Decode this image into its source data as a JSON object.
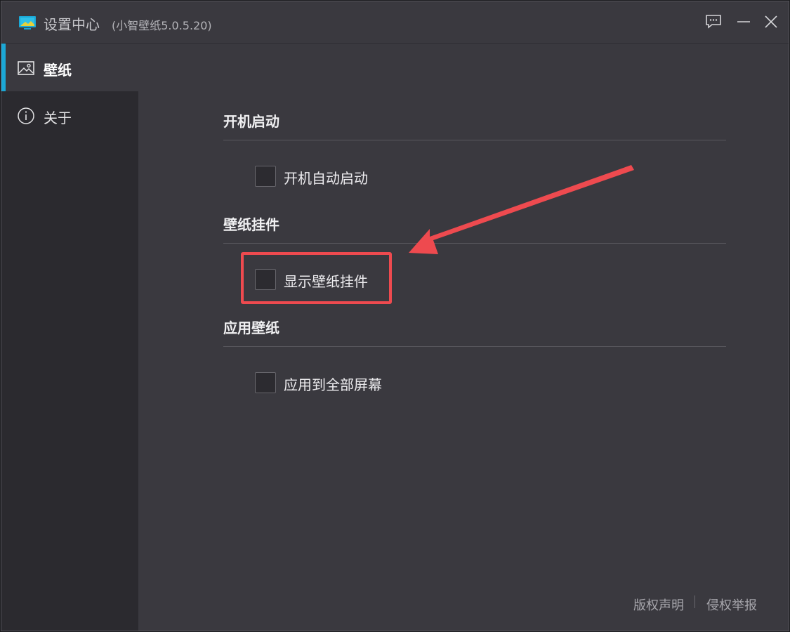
{
  "window": {
    "title": "设置中心",
    "version": "(小智壁纸5.0.5.20)"
  },
  "titlebar_buttons": {
    "feedback_icon": "speech-bubble",
    "minimize_icon": "minus",
    "close_icon": "x"
  },
  "sidebar": {
    "items": [
      {
        "label": "壁纸",
        "icon": "image-icon",
        "active": true
      },
      {
        "label": "关于",
        "icon": "info-icon",
        "active": false
      }
    ]
  },
  "sections": [
    {
      "title": "开机启动",
      "option_label": "开机自动启动",
      "checked": false
    },
    {
      "title": "壁纸挂件",
      "option_label": "显示壁纸挂件",
      "checked": false
    },
    {
      "title": "应用壁纸",
      "option_label": "应用到全部屏幕",
      "checked": false
    }
  ],
  "footer": {
    "copyright_link": "版权声明",
    "report_link": "侵权举报"
  },
  "colors": {
    "accent": "#1ba8d6",
    "annotation": "#ee4a4f",
    "background": "#3a393f",
    "sidebar": "#2b2a2f"
  }
}
